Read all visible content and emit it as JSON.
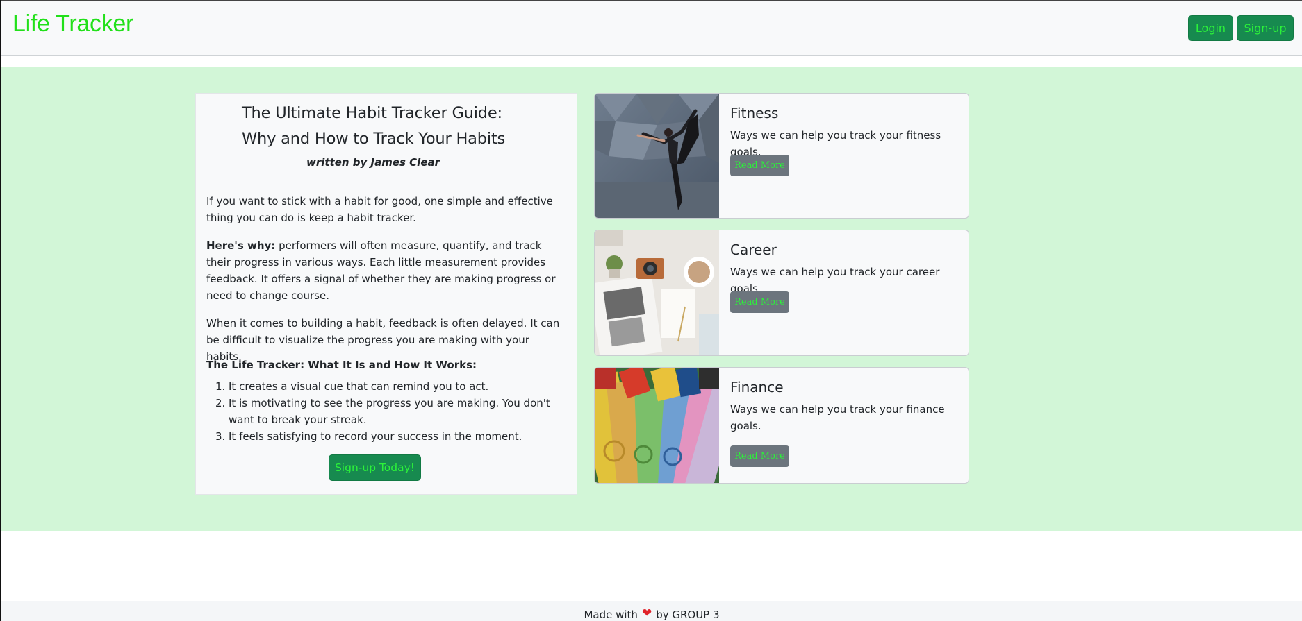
{
  "navbar": {
    "brand": "Life Tracker",
    "login_label": "Login",
    "signup_label": "Sign-up",
    "brand_color": "#22e01a",
    "button_color": "#178a4f"
  },
  "hero": {
    "background": "#d2f6d7"
  },
  "article": {
    "title_line1": "The Ultimate Habit Tracker Guide:",
    "title_line2": "Why and How to Track Your Habits",
    "byline": "written by James Clear",
    "para1": "If you want to stick with a habit for good, one simple and effective thing you can do is keep a habit tracker.",
    "para2_bold": "Here's why:",
    "para2_rest": " performers will often measure, quantify, and track their progress in various ways. Each little measurement provides feedback. It offers a signal of whether they are making progress or need to change course.",
    "para3": "When it comes to building a habit, feedback is often delayed. It can be difficult to visualize the progress you are making with your habits.",
    "subhead": "The Life Tracker: What It Is and How It Works:",
    "steps": [
      {
        "num": "1.",
        "text": "It creates a visual cue that can remind you to act."
      },
      {
        "num": "2.",
        "text": "It is motivating to see the progress you are making. You don't want to break your streak."
      },
      {
        "num": "3.",
        "text": "It feels satisfying to record your success in the moment."
      }
    ],
    "cta_label": "Sign-up Today!"
  },
  "cards": [
    {
      "title": "Fitness",
      "desc": "Ways we can help you track your fitness goals.",
      "button": "Read More",
      "image": "yoga-pose-photo"
    },
    {
      "title": "Career",
      "desc": "Ways we can help you track your career goals.",
      "button": "Read More",
      "image": "desk-flatlay-photo"
    },
    {
      "title": "Finance",
      "desc": "Ways we can help you track your finance goals.",
      "button": "Read More",
      "image": "euro-banknotes-photo"
    }
  ],
  "footer": {
    "made_with": "Made with",
    "heart_icon": "heart-icon",
    "by": "by GROUP 3",
    "heart_color": "#e0222a"
  }
}
